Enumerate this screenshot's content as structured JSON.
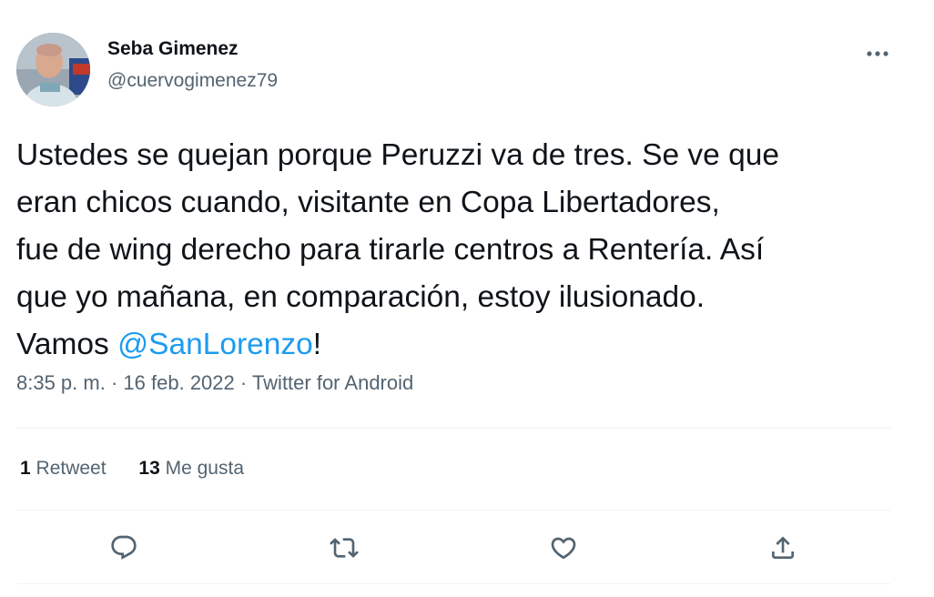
{
  "user": {
    "name": "Seba Gimenez",
    "handle": "@cuervogimenez79"
  },
  "tweet": {
    "lines": [
      "Ustedes se quejan porque Peruzzi va de tres. Se ve que",
      "eran chicos cuando, visitante en Copa Libertadores,",
      "fue de wing derecho para tirarle centros a Rentería. Así",
      "que yo mañana, en comparación, estoy ilusionado."
    ],
    "last_line_prefix": "Vamos ",
    "mention": "@SanLorenzo",
    "last_line_suffix": "!"
  },
  "meta": {
    "time": "8:35 p. m.",
    "separator": "·",
    "date": "16 feb. 2022",
    "source": "Twitter for Android"
  },
  "stats": {
    "retweets_count": "1",
    "retweets_label": "Retweet",
    "likes_count": "13",
    "likes_label": "Me gusta"
  },
  "icons": {
    "more": "more-horizontal-icon",
    "reply": "reply-icon",
    "retweet": "retweet-icon",
    "like": "heart-icon",
    "share": "share-icon"
  },
  "colors": {
    "text": "#0f1419",
    "secondary": "#536471",
    "link": "#1d9bf0",
    "divider": "#eff3f4"
  }
}
